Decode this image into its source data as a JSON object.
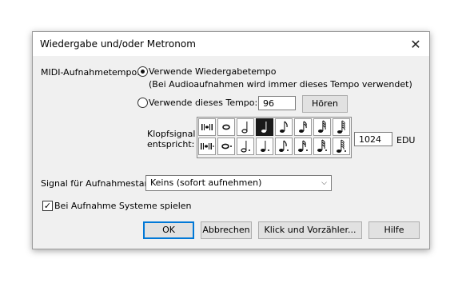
{
  "window": {
    "title": "Wiedergabe und/oder Metronom",
    "close_symbol": "✕"
  },
  "tempo": {
    "label": "MIDI-Aufnahmetempo:",
    "option_playback": "Verwende Wiedergabetempo",
    "playback_note": "(Bei Audioaufnahmen wird immer dieses Tempo verwendet)",
    "option_fixed": "Verwende dieses Tempo:",
    "fixed_value": "96",
    "listen_button": "Hören",
    "selected": "playback"
  },
  "click": {
    "label_line1": "Klopfsignal",
    "label_line2": "entspricht:",
    "edu_value": "1024",
    "edu_label": "EDU",
    "selected_note": "quarter",
    "notes_row1": [
      "beat-icon",
      "whole-note-icon",
      "half-note-icon",
      "quarter-note-icon",
      "eighth-note-icon",
      "sixteenth-note-icon",
      "thirty-second-note-icon",
      "sixty-fourth-note-icon"
    ],
    "notes_row2": [
      "dotted-beat-icon",
      "dotted-whole-note-icon",
      "dotted-half-note-icon",
      "dotted-quarter-note-icon",
      "dotted-eighth-note-icon",
      "dotted-sixteenth-note-icon",
      "dotted-thirty-second-note-icon",
      "dotted-sixty-fourth-note-icon"
    ]
  },
  "signal": {
    "label": "Signal für Aufnahmestart:",
    "selected": "Keins (sofort aufnehmen)"
  },
  "systems": {
    "label": "Bei Aufnahme Systeme spielen",
    "checked": true
  },
  "buttons": {
    "ok": "OK",
    "cancel": "Abbrechen",
    "click_countoff": "Klick und Vorzähler...",
    "help": "Hilfe"
  }
}
